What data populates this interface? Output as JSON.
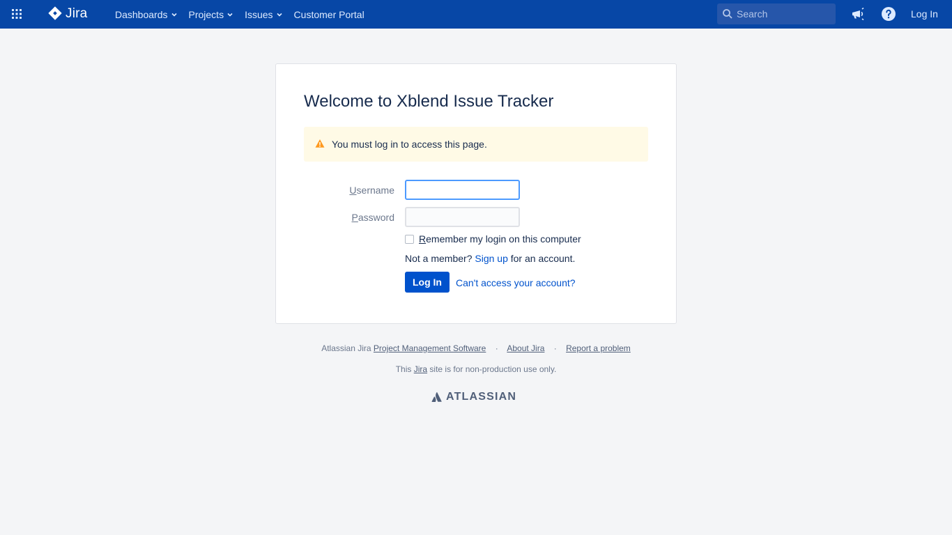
{
  "header": {
    "brand": "Jira",
    "nav": [
      {
        "label": "Dashboards",
        "has_menu": true
      },
      {
        "label": "Projects",
        "has_menu": true
      },
      {
        "label": "Issues",
        "has_menu": true
      },
      {
        "label": "Customer Portal",
        "has_menu": false
      }
    ],
    "search_placeholder": "Search",
    "login_label": "Log In",
    "icons": [
      "app-switcher-icon",
      "jira-logo-icon",
      "search-icon",
      "megaphone-icon",
      "help-icon"
    ],
    "colors": {
      "bar": "#0747a6",
      "text": "#deebff"
    }
  },
  "login": {
    "title": "Welcome to Xblend Issue Tracker",
    "warning": "You must log in to access this page.",
    "username_label_first": "U",
    "username_label_rest": "sername",
    "username_value": "",
    "password_label_first": "P",
    "password_label_rest": "assword",
    "password_value": "",
    "remember_first": "R",
    "remember_rest": "emember my login on this computer",
    "remember_checked": false,
    "not_member": "Not a member?",
    "sign_up": "Sign up",
    "for_account": "for an account.",
    "submit": "Log In",
    "cant_access": "Can't access your account?",
    "colors": {
      "primary": "#0052cc",
      "warning_bg": "#fffae6",
      "warning_icon": "#ff991f"
    }
  },
  "footer": {
    "prefix": "Atlassian Jira",
    "pms_link": "Project Management Software",
    "about": "About Jira",
    "report": "Report a problem",
    "line2_pre": "This",
    "line2_link": "Jira",
    "line2_post": "site is for non-production use only.",
    "separator": "·",
    "brand": "ATLASSIAN"
  }
}
